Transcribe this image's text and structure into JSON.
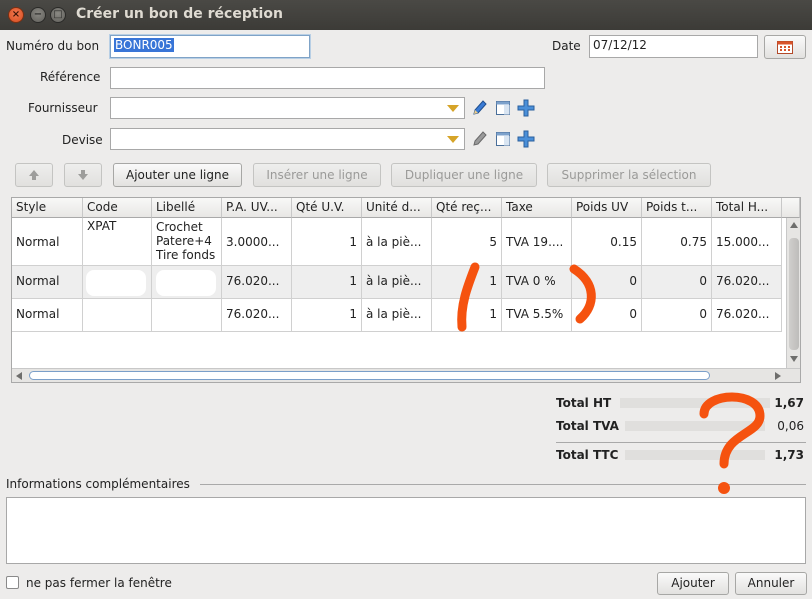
{
  "window": {
    "title": "Créer un bon de réception",
    "close_glyph": "×",
    "minimize_glyph": "−",
    "maximize_glyph": "□"
  },
  "form": {
    "numero_label": "Numéro du bon",
    "numero_value": "BONR005",
    "date_label": "Date",
    "date_value": "07/12/12",
    "reference_label": "Référence",
    "reference_value": "",
    "fournisseur_label": "Fournisseur",
    "fournisseur_value": "",
    "devise_label": "Devise",
    "devise_value": ""
  },
  "toolbar": {
    "add_line": "Ajouter une ligne",
    "insert_line": "Insérer une ligne",
    "duplicate_line": "Dupliquer une ligne",
    "delete_selection": "Supprimer la sélection"
  },
  "table": {
    "columns": [
      "Style",
      "Code",
      "Libellé",
      "P.A. UV...",
      "Qté U.V.",
      "Unité d...",
      "Qté reç...",
      "Taxe",
      "Poids UV",
      "Poids t...",
      "Total H..."
    ],
    "rows": [
      {
        "style": "Normal",
        "code": "XPAT",
        "libelle_lines": [
          "Crochet",
          "Patere+4",
          "Tire fonds"
        ],
        "pa": "3.0000...",
        "qte_uv": "1",
        "unite": "à la piè...",
        "qte_recue": "5",
        "taxe": "TVA 19....",
        "poids_uv": "0.15",
        "poids_total": "0.75",
        "total_ht": "15.000..."
      },
      {
        "style": "Normal",
        "code": "",
        "libelle_lines": [
          ""
        ],
        "pa": "76.020...",
        "qte_uv": "1",
        "unite": "à la piè...",
        "qte_recue": "1",
        "taxe": "TVA 0 %",
        "poids_uv": "0",
        "poids_total": "0",
        "total_ht": "76.020..."
      },
      {
        "style": "Normal",
        "code": "",
        "libelle_lines": [
          ""
        ],
        "pa": "76.020...",
        "qte_uv": "1",
        "unite": "à la piè...",
        "qte_recue": "1",
        "taxe": "TVA 5.5%",
        "poids_uv": "0",
        "poids_total": "0",
        "total_ht": "76.020..."
      }
    ]
  },
  "totals": {
    "ht_label": "Total HT",
    "ht_value": "1,67",
    "tva_label": "Total TVA",
    "tva_value": "0,06",
    "ttc_label": "Total TTC",
    "ttc_value": "1,73"
  },
  "info": {
    "label": "Informations complémentaires",
    "value": ""
  },
  "footer": {
    "keep_open_label": "ne pas fermer la fenêtre",
    "keep_open_checked": false,
    "add_button": "Ajouter",
    "cancel_button": "Annuler"
  },
  "colors": {
    "annotation": "#f5520f",
    "selection": "#3875d7",
    "combo_arrow": "#d6a428",
    "plus_icon": "#4a8fd8"
  },
  "icons": [
    "calendar-icon",
    "edit-pencil-icon",
    "detail-window-icon",
    "add-plus-icon",
    "arrow-up-icon",
    "arrow-down-icon"
  ]
}
